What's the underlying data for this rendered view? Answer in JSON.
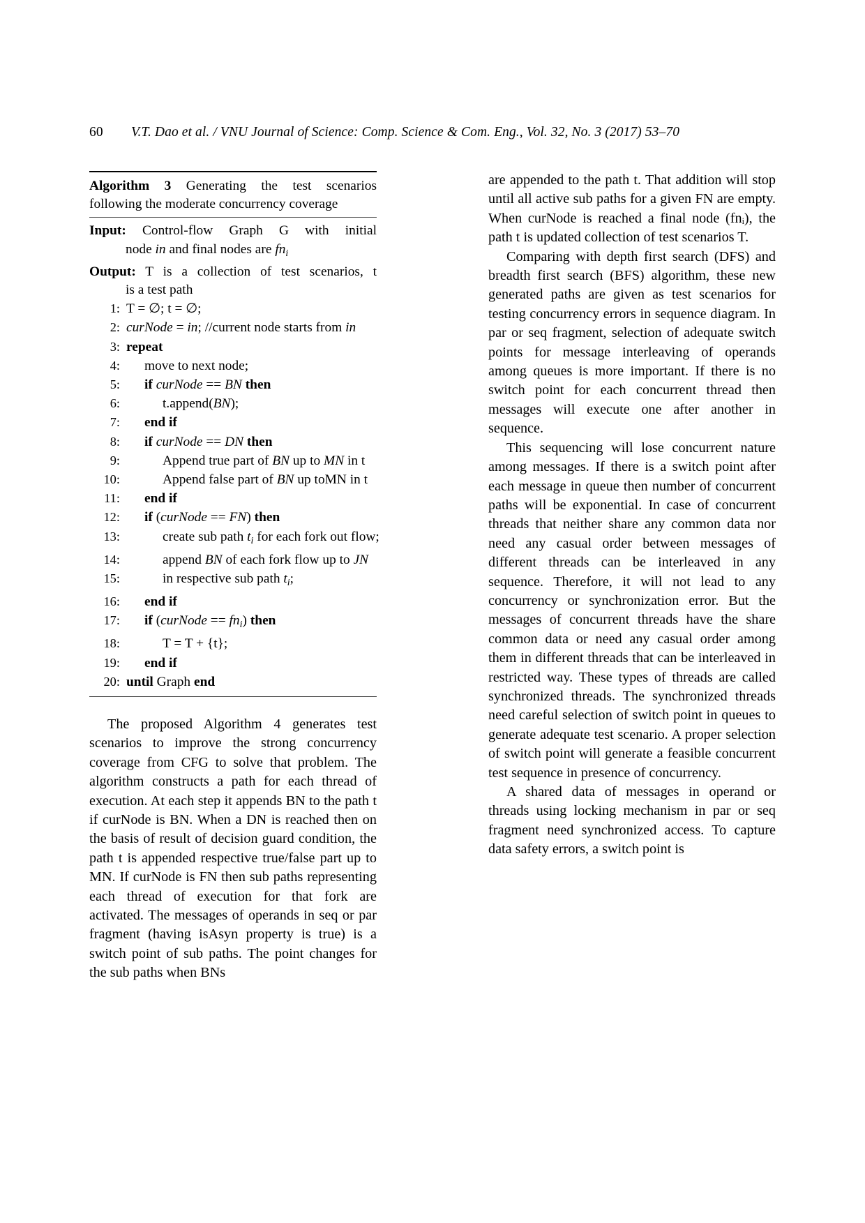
{
  "header": {
    "folio": "60",
    "citation": "V.T. Dao et al. / VNU Journal of Science: Comp. Science & Com. Eng., Vol. 32, No. 3 (2017) 53–70"
  },
  "algorithm": {
    "label": "Algorithm 3",
    "title": "Generating the test scenarios following the moderate concurrency coverage",
    "title_line1": "Generating the test scenarios",
    "title_line2": "following the moderate concurrency coverage",
    "input_label": "Input:",
    "input_line1": "Control-flow Graph G with initial",
    "input_line2_a": "node ",
    "input_line2_in": "in",
    "input_line2_b": " and final nodes are ",
    "input_line2_fn": "fn",
    "input_line2_fn_sub": "i",
    "output_label": "Output:",
    "output_line1": "T is a collection of test scenarios, t",
    "output_line2": "is a test path",
    "lines": [
      {
        "n": "1:",
        "indent": 1,
        "text": "T = ∅; t = ∅;"
      },
      {
        "n": "2:",
        "indent": 1,
        "text": "curNode = in; //current node starts from in"
      },
      {
        "n": "3:",
        "indent": 1,
        "text": "repeat"
      },
      {
        "n": "4:",
        "indent": 2,
        "text": "move to next node;"
      },
      {
        "n": "5:",
        "indent": 2,
        "text": "if curNode == BN then"
      },
      {
        "n": "6:",
        "indent": 3,
        "text": "t.append(BN);"
      },
      {
        "n": "7:",
        "indent": 2,
        "text": "end if"
      },
      {
        "n": "8:",
        "indent": 2,
        "text": "if curNode == DN then"
      },
      {
        "n": "9:",
        "indent": 3,
        "text": "Append true part of BN up to MN in t"
      },
      {
        "n": "10:",
        "indent": 3,
        "text": "Append false part of BN up toMN in t"
      },
      {
        "n": "11:",
        "indent": 2,
        "text": "end if"
      },
      {
        "n": "12:",
        "indent": 2,
        "text": "if (curNode == FN) then"
      },
      {
        "n": "13:",
        "indent": 3,
        "text": "create sub path tᵢ for each fork out flow;"
      },
      {
        "n": "14:",
        "indent": 3,
        "text": "append BN of each fork flow up to JN"
      },
      {
        "n": "15:",
        "indent": 3,
        "text": "in respective sub path tᵢ;"
      },
      {
        "n": "16:",
        "indent": 2,
        "text": "end if"
      },
      {
        "n": "17:",
        "indent": 2,
        "text": "if (curNode == fnᵢ) then"
      },
      {
        "n": "18:",
        "indent": 3,
        "text": "T = T + {t};"
      },
      {
        "n": "19:",
        "indent": 2,
        "text": "end if"
      },
      {
        "n": "20:",
        "indent": 1,
        "text": "until Graph end"
      }
    ]
  },
  "left_column": {
    "paragraph_1": "The proposed Algorithm 4 generates test scenarios to improve the strong concurrency coverage from CFG to solve that problem. The algorithm constructs a path for each thread of execution. At each step it appends BN to the path t if curNode is BN. When a DN is reached then on the basis of result of decision guard condition, the path t is appended respective true/false part up to MN. If curNode is FN then sub paths representing each thread of execution for that fork are activated. The messages of operands in seq or par fragment (having isAsyn property is true) is a switch point of sub paths. The point changes for the sub paths when BNs"
  },
  "right_column": {
    "paragraph_1": "are appended to the path t. That addition will stop until all active sub paths for a given FN are empty. When curNode is reached a final node (fnᵢ), the path t is updated collection of test scenarios T.",
    "paragraph_2": "Comparing with depth first search (DFS) and breadth first search (BFS) algorithm, these new generated paths are given as test scenarios for testing concurrency errors in sequence diagram.  In par or seq fragment, selection of adequate switch points for message interleaving of operands among queues is more important.  If there is no switch point for each concurrent thread then messages will execute one after another in sequence.",
    "paragraph_3": "This sequencing will lose concurrent nature among messages.  If there is a switch point after each message in queue then number of concurrent paths will be exponential.  In case of concurrent threads that neither share any common data nor need any casual order between messages of different threads can be interleaved in any sequence.  Therefore, it will not lead to any concurrency or synchronization error. But the messages of concurrent threads have the share common data or need any casual order among them in different threads that can be interleaved in restricted way.  These types of threads are called synchronized threads.  The synchronized threads need careful selection of switch point in queues to generate adequate test scenario. A proper selection of switch point will generate a feasible concurrent test sequence in presence of concurrency.",
    "paragraph_4": "A shared data of messages in operand or threads using locking mechanism in par or seq fragment need synchronized access. To capture data safety errors, a switch point is"
  }
}
